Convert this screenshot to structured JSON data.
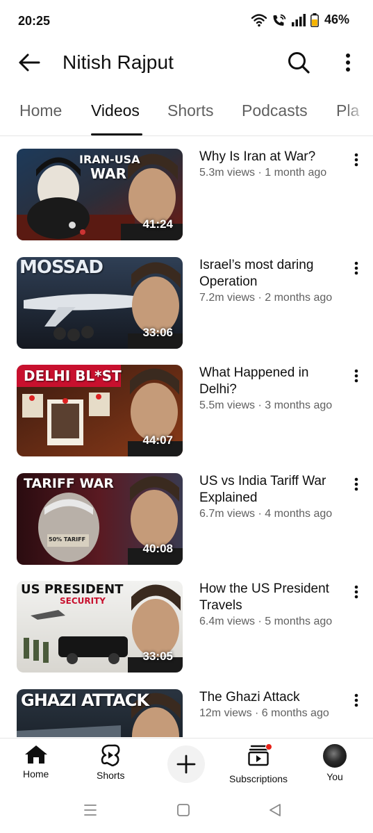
{
  "status_bar": {
    "time": "20:25",
    "battery_percent": "46%",
    "icons": [
      "wifi-icon",
      "wifi-calling-icon",
      "signal-icon",
      "battery-icon"
    ]
  },
  "app_bar": {
    "title": "Nitish Rajput",
    "icons": [
      "back-arrow-icon",
      "search-icon",
      "more-vert-icon"
    ]
  },
  "tabs": [
    {
      "label": "Home",
      "active": false
    },
    {
      "label": "Videos",
      "active": true
    },
    {
      "label": "Shorts",
      "active": false
    },
    {
      "label": "Podcasts",
      "active": false
    },
    {
      "label": "Pla",
      "active": false
    }
  ],
  "videos": [
    {
      "title": "Why Is Iran at War?",
      "meta": "5.3m views · 1 month ago",
      "duration": "41:24",
      "thumb_text": [
        "IRAN-USA",
        "WAR"
      ]
    },
    {
      "title": "Israel’s most daring Operation",
      "meta": "7.2m views · 2 months ago",
      "duration": "33:06",
      "thumb_text": [
        "MOSSAD"
      ]
    },
    {
      "title": "What Happened in Delhi?",
      "meta": "5.5m views · 3 months ago",
      "duration": "44:07",
      "thumb_text": [
        "DELHI BL*ST"
      ]
    },
    {
      "title": "US vs India Tariff War Explained",
      "meta": "6.7m views · 4 months ago",
      "duration": "40:08",
      "thumb_text": [
        "TARIFF WAR",
        "50% TARIFF"
      ]
    },
    {
      "title": "How the US President Travels",
      "meta": "6.4m views · 5 months ago",
      "duration": "33:05",
      "thumb_text": [
        "US PRESIDENT",
        "SECURITY"
      ]
    },
    {
      "title": "The Ghazi Attack",
      "meta": "12m views · 6 months ago",
      "duration": "",
      "thumb_text": [
        "GHAZI ATTACK"
      ]
    }
  ],
  "bottom_nav": [
    {
      "label": "Home",
      "icon": "home-icon"
    },
    {
      "label": "Shorts",
      "icon": "shorts-icon"
    },
    {
      "label": "",
      "icon": "plus-icon"
    },
    {
      "label": "Subscriptions",
      "icon": "subscriptions-icon"
    },
    {
      "label": "You",
      "icon": "avatar"
    }
  ],
  "colors": {
    "text_primary": "#0f0f0f",
    "text_secondary": "#606060",
    "notification_red": "#e62117"
  }
}
